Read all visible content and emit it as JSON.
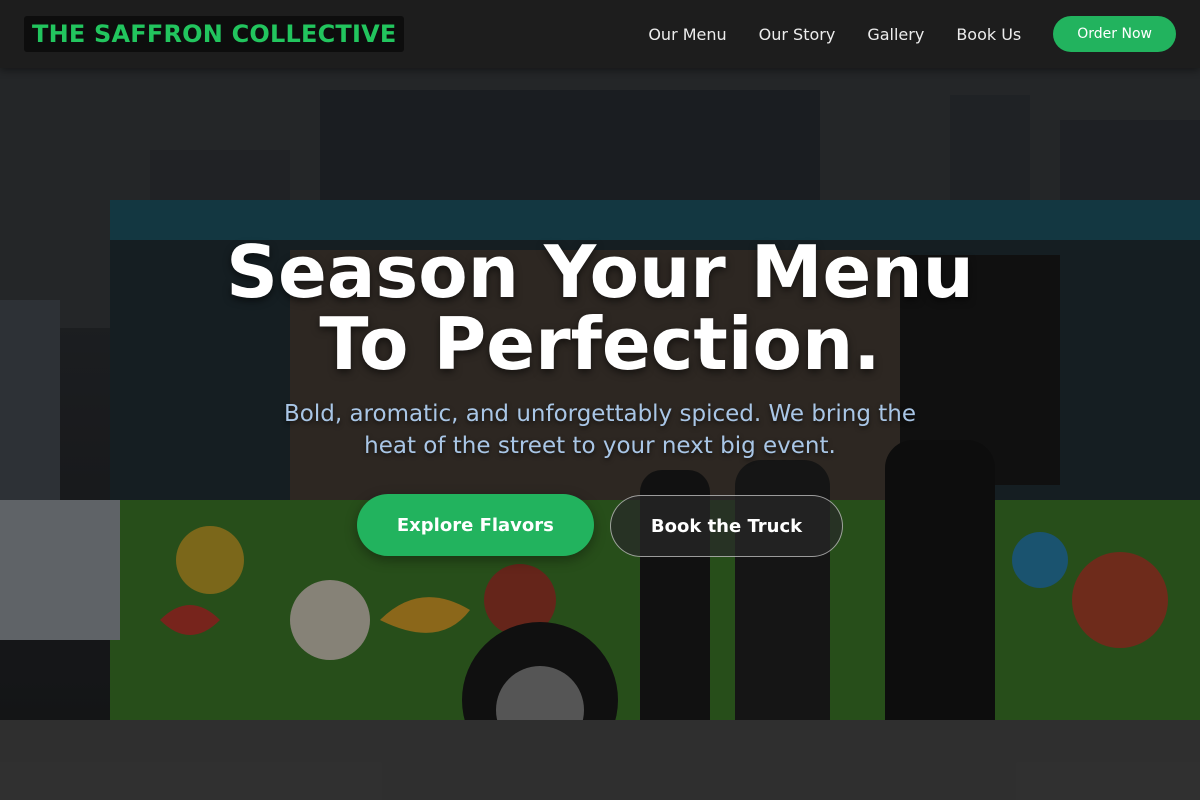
{
  "brand": {
    "name": "THE SAFFRON COLLECTIVE",
    "color": "#22c55e"
  },
  "nav": {
    "links": [
      {
        "label": "Our Menu"
      },
      {
        "label": "Our Story"
      },
      {
        "label": "Gallery"
      },
      {
        "label": "Book Us"
      }
    ],
    "cta_label": "Order Now"
  },
  "hero": {
    "title_line1": "Season Your Menu",
    "title_line2": "To Perfection.",
    "subtitle": "Bold, aromatic, and unforgettably spiced. We bring the heat of the street to your next big event.",
    "primary_button": "Explore Flavors",
    "secondary_button": "Book the Truck",
    "background_image": "food-truck-photo"
  },
  "colors": {
    "accent": "#22b35e",
    "navbar_bg": "#1d1d1d",
    "subtitle_text": "#a9c6e6"
  }
}
